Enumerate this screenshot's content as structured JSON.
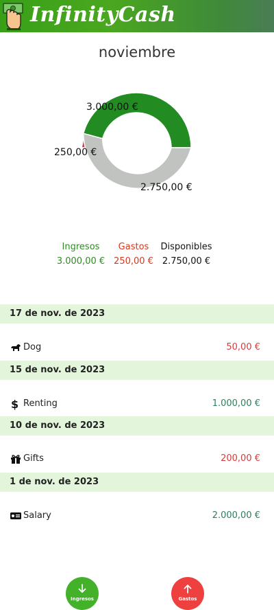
{
  "app": {
    "title": "InfinityCash"
  },
  "month": "noviembre",
  "colors": {
    "ingresos": "#2e8b22",
    "gastos": "#dc3545",
    "disponibles": "#c0c3bf",
    "header": "#43a81c"
  },
  "chart_data": {
    "type": "pie",
    "categories": [
      "Ingresos",
      "Gastos",
      "Disponibles"
    ],
    "values": [
      3000,
      250,
      2750
    ],
    "data_labels": [
      "3.000,00 €",
      "250,00 €",
      "2.750,00 €"
    ],
    "colors": [
      "#228b22",
      "#dc3545",
      "#c0c3bf"
    ]
  },
  "summary": {
    "ingresos": {
      "label": "Ingresos",
      "value": "3.000,00 €"
    },
    "gastos": {
      "label": "Gastos",
      "value": "250,00 €"
    },
    "disponibles": {
      "label": "Disponibles",
      "value": "2.750,00 €"
    }
  },
  "transactions": [
    {
      "date": "17 de nov. de 2023",
      "icon": "dog-icon",
      "label": "Dog",
      "amount": "50,00 €",
      "type": "expense"
    },
    {
      "date": "15 de nov. de 2023",
      "icon": "dollar-icon",
      "label": "Renting",
      "amount": "1.000,00 €",
      "type": "income"
    },
    {
      "date": "10 de nov. de 2023",
      "icon": "gift-icon",
      "label": "Gifts",
      "amount": "200,00 €",
      "type": "expense"
    },
    {
      "date": "1 de nov. de 2023",
      "icon": "money-bill-icon",
      "label": "Salary",
      "amount": "2.000,00 €",
      "type": "income"
    }
  ],
  "fabs": {
    "ingresos": {
      "label": "Ingresos",
      "icon": "arrow-down-icon"
    },
    "gastos": {
      "label": "Gastos",
      "icon": "arrow-up-icon"
    }
  }
}
